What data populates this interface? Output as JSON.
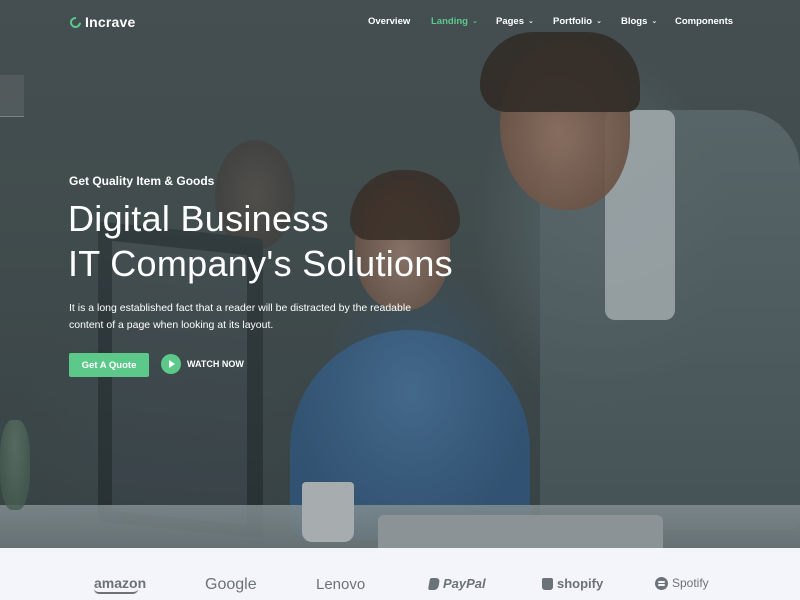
{
  "brand": {
    "name": "Incrave",
    "accent": "#5cc98a"
  },
  "nav": {
    "items": [
      {
        "label": "Overview",
        "active": false,
        "has_dropdown": false
      },
      {
        "label": "Landing",
        "active": true,
        "has_dropdown": true
      },
      {
        "label": "Pages",
        "active": false,
        "has_dropdown": true
      },
      {
        "label": "Portfolio",
        "active": false,
        "has_dropdown": true
      },
      {
        "label": "Blogs",
        "active": false,
        "has_dropdown": true
      },
      {
        "label": "Components",
        "active": false,
        "has_dropdown": false
      }
    ],
    "dropdown_glyph": "⌄"
  },
  "hero": {
    "eyebrow": "Get Quality Item & Goods",
    "title_line1": "Digital Business",
    "title_line2": "IT Company's Solutions",
    "lead": "It is a long established fact that a reader will be distracted by the readable content of a page when looking at its layout.",
    "cta_label": "Get A Quote",
    "watch_label": "WATCH NOW"
  },
  "clients": [
    {
      "name": "amazon",
      "icon": "amazon-smile"
    },
    {
      "name": "Google",
      "icon": null
    },
    {
      "name": "Lenovo",
      "icon": null
    },
    {
      "name": "PayPal",
      "icon": "paypal-icon"
    },
    {
      "name": "shopify",
      "icon": "shopify-bag-icon"
    },
    {
      "name": "Spotify",
      "icon": "spotify-icon"
    }
  ]
}
